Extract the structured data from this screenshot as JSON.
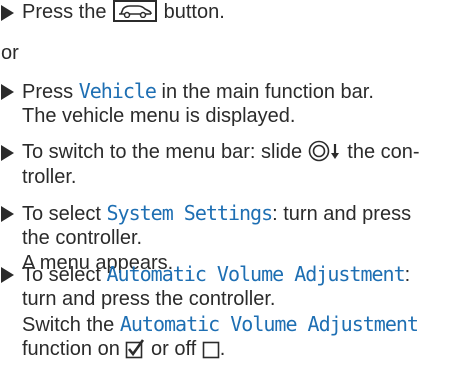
{
  "steps": [
    {
      "before": "Press the",
      "after": "button."
    },
    {
      "or": "or"
    },
    {
      "line1_prefix": "Press",
      "line1_highlight": "Vehicle",
      "line1_suffix": "in the main function bar.",
      "line2": "The vehicle menu is displayed."
    },
    {
      "line1_prefix": "To switch to the menu bar: slide",
      "line1_suffix": "the con-",
      "line2": "troller."
    },
    {
      "line1_prefix": "To select",
      "line1_highlight": "System Settings",
      "line1_suffix": ": turn and press",
      "line2": "the controller.",
      "line3": "A menu appears."
    },
    {
      "line1_prefix": "To select",
      "line1_highlight": "Automatic Volume Adjustment",
      "line1_suffix": ":",
      "line2": "turn and press the controller.",
      "line3_prefix": "Switch the",
      "line3_highlight": "Automatic Volume Adjustment",
      "line4_prefix": "function on",
      "line4_mid": "or off",
      "line4_suffix": "."
    }
  ],
  "colors": {
    "text": "#2b2b2b",
    "highlight": "#1e6fb3"
  },
  "icons": [
    "bullet-arrow-icon",
    "car-button-icon",
    "controller-slide-down-icon",
    "checkbox-checked-icon",
    "checkbox-empty-icon"
  ]
}
